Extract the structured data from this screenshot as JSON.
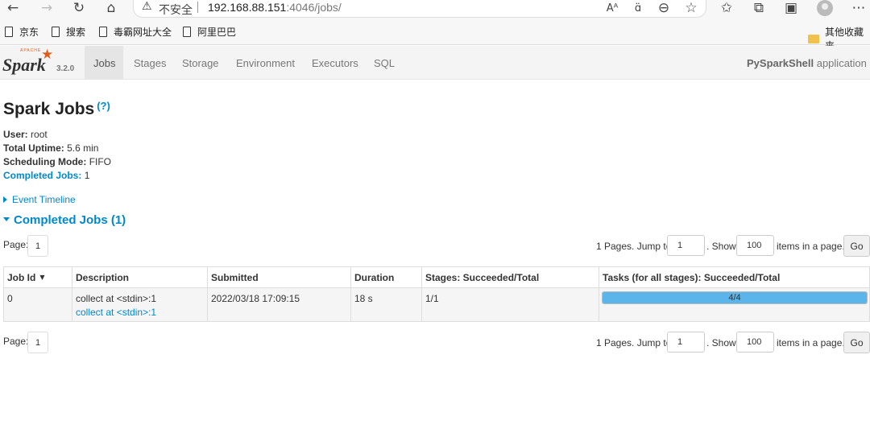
{
  "browser": {
    "insecure_label": "不安全",
    "url_host": "192.168.88.151",
    "url_path": ":4046/jobs/"
  },
  "bookmarks": [
    {
      "label": "京东"
    },
    {
      "label": "搜索"
    },
    {
      "label": "毒霸网址大全"
    },
    {
      "label": "阿里巴巴"
    }
  ],
  "bookmarks_folder": "其他收藏夹",
  "nav": {
    "logo_text": "Spark",
    "logo_apache": "APACHE",
    "version": "3.2.0",
    "tabs": [
      "Jobs",
      "Stages",
      "Storage",
      "Environment",
      "Executors",
      "SQL"
    ],
    "active_tab": "Jobs",
    "app_name": "PySparkShell",
    "app_suffix": " application UI"
  },
  "page": {
    "title": "Spark Jobs",
    "help": "(?)",
    "user_label": "User:",
    "user": "root",
    "uptime_label": "Total Uptime:",
    "uptime": "5.6 min",
    "sched_label": "Scheduling Mode:",
    "sched": "FIFO",
    "completed_label": "Completed Jobs:",
    "completed": "1",
    "event_timeline": "Event Timeline",
    "completed_header": "Completed Jobs (1)"
  },
  "pager": {
    "page_label": "Page:",
    "page": "1",
    "pages_text": "1 Pages. Jump to",
    "jump_value": "1",
    "show_text": ". Show",
    "show_value": "100",
    "items_text": "items in a page.",
    "go_label": "Go"
  },
  "table": {
    "headers": [
      "Job Id",
      "Description",
      "Submitted",
      "Duration",
      "Stages: Succeeded/Total",
      "Tasks (for all stages): Succeeded/Total"
    ],
    "sort_indicator": "▼",
    "rows": [
      {
        "job_id": "0",
        "description": "collect at <stdin>:1",
        "description_link": "collect at <stdin>:1",
        "submitted": "2022/03/18 17:09:15",
        "duration": "18 s",
        "stages": "1/1",
        "tasks": "4/4",
        "tasks_fraction": 1.0
      }
    ]
  },
  "colors": {
    "link": "#0088cc",
    "progress": "#5bb5ea",
    "spark_orange": "#e25a1c"
  }
}
